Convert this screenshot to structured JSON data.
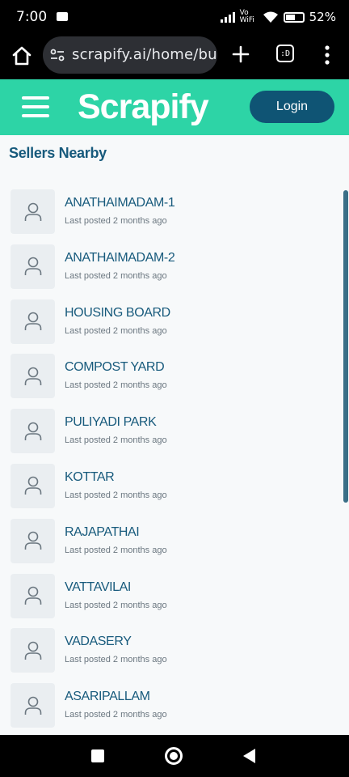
{
  "status_bar": {
    "time": "7:00",
    "network": "Vo WiFi",
    "battery": "52"
  },
  "browser": {
    "url": "scrapify.ai/home/buyer",
    "tabs_label": ":D",
    "icons": [
      "home-icon",
      "site-settings-icon",
      "plus-icon",
      "tab-switcher-icon",
      "more-vert-icon"
    ]
  },
  "header": {
    "brand": "Scrapify",
    "login_label": "Login",
    "accent_color": "#2dd4a6",
    "button_color": "#0f5474"
  },
  "main": {
    "section_title": "Sellers Nearby",
    "sellers": [
      {
        "name": "ANATHAIMADAM-1",
        "meta": "Last posted 2 months ago"
      },
      {
        "name": "ANATHAIMADAM-2",
        "meta": "Last posted 2 months ago"
      },
      {
        "name": "HOUSING BOARD",
        "meta": "Last posted 2 months ago"
      },
      {
        "name": "COMPOST YARD",
        "meta": "Last posted 2 months ago"
      },
      {
        "name": "PULIYADI PARK",
        "meta": "Last posted 2 months ago"
      },
      {
        "name": "KOTTAR",
        "meta": "Last posted 2 months ago"
      },
      {
        "name": "RAJAPATHAI",
        "meta": "Last posted 2 months ago"
      },
      {
        "name": "VATTAVILAI",
        "meta": "Last posted 2 months ago"
      },
      {
        "name": "VADASERY",
        "meta": "Last posted 2 months ago"
      },
      {
        "name": "ASARIPALLAM",
        "meta": "Last posted 2 months ago"
      }
    ]
  },
  "nav_bar": {
    "icons": [
      "recents-icon",
      "home-circle-icon",
      "back-icon"
    ]
  }
}
